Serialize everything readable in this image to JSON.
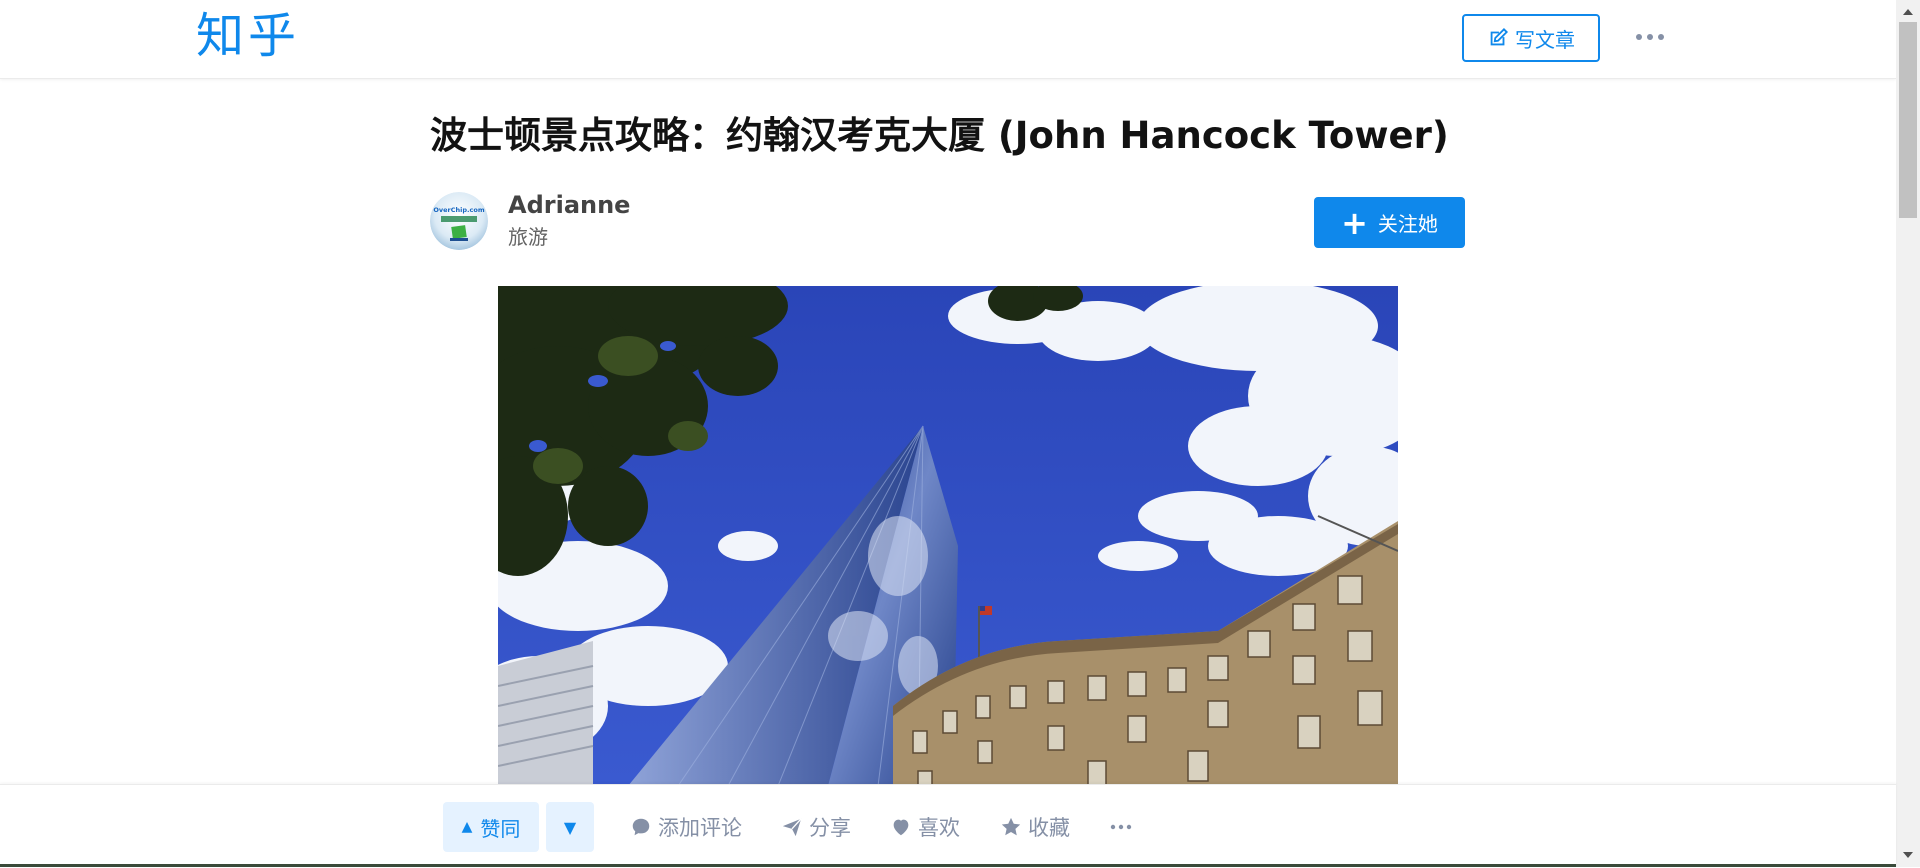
{
  "header": {
    "logo_text": "知乎",
    "write_button_label": "写文章",
    "more_label": "···"
  },
  "article": {
    "title": "波士顿景点攻略：约翰汉考克大厦 (John Hancock Tower)",
    "author": {
      "name": "Adrianne",
      "headline": "旅游",
      "avatar_text": "OverChip.com",
      "follow_label": "关注她",
      "follow_icon": "+"
    }
  },
  "actions": {
    "upvote_label": "赞同",
    "upvote_icon": "▲",
    "downvote_icon": "▼",
    "comment_label": "添加评论",
    "share_label": "分享",
    "like_label": "喜欢",
    "collect_label": "收藏",
    "more_label": "···"
  },
  "colors": {
    "brand": "#0f88eb",
    "action_gray": "#8590a6",
    "vote_bg": "#e5f2ff"
  }
}
